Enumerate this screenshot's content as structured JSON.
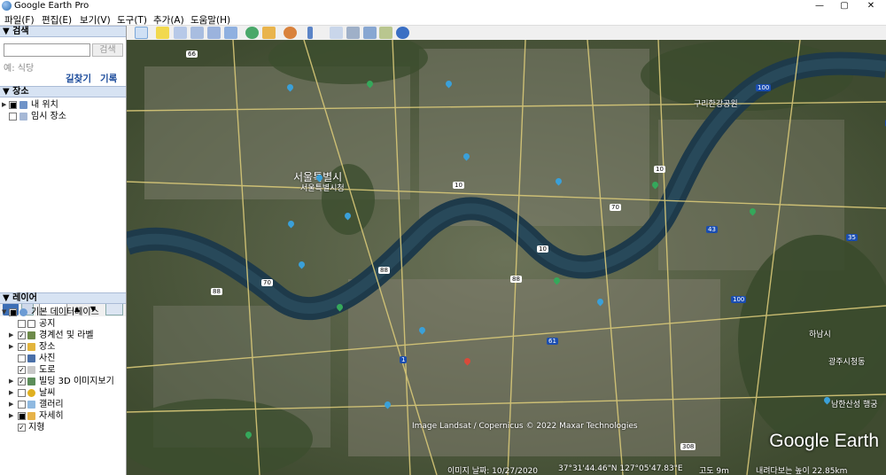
{
  "window": {
    "title": "Google Earth Pro",
    "minimize": "—",
    "maximize": "▢",
    "close": "✕"
  },
  "menu": [
    "파일(F)",
    "편집(E)",
    "보기(V)",
    "도구(T)",
    "추가(A)",
    "도움말(H)"
  ],
  "search": {
    "header": "검색",
    "button": "검색",
    "hint": "예: 식당",
    "directions": "길찾기",
    "history": "기록"
  },
  "places": {
    "header": "장소",
    "items": [
      {
        "label": "내 위치"
      },
      {
        "label": "임시 장소"
      }
    ]
  },
  "layers": {
    "header": "레이어",
    "items": [
      {
        "label": "기본 데이터베이스",
        "checked": false
      },
      {
        "label": "공지",
        "checked": false
      },
      {
        "label": "경계선 및 라벨",
        "checked": true
      },
      {
        "label": "장소",
        "checked": true
      },
      {
        "label": "사진",
        "checked": false
      },
      {
        "label": "도로",
        "checked": true
      },
      {
        "label": "빌딩 3D 이미지보기",
        "checked": true
      },
      {
        "label": "날씨",
        "checked": false
      },
      {
        "label": "갤러리",
        "checked": false
      },
      {
        "label": "자세히",
        "checked": false
      },
      {
        "label": "지형",
        "checked": true
      }
    ]
  },
  "map": {
    "labels": {
      "seoul": "서울특별시",
      "seoul_city_hall": "서울특별시청",
      "guri": "구리한강공원",
      "hanam": "하남시",
      "gwangju": "광주시청동",
      "namhansanseong": "남한산성 행궁"
    },
    "highways": [
      "66",
      "70",
      "70",
      "10",
      "10",
      "10",
      "88",
      "88",
      "88",
      "43",
      "35",
      "100",
      "100",
      "61",
      "1",
      "308",
      "100"
    ],
    "copyright": "Image Landsat / Copernicus   © 2022 Maxar Technologies",
    "brand": "Google Earth",
    "status": {
      "imagery_date": "이미지 날짜: 10/27/2020",
      "coords": "37°31'44.46\"N  127°05'47.83\"E",
      "elevation": "고도   9m",
      "eye_alt": "내려다보는 높이  22.85km"
    }
  },
  "colors": {
    "panel_header": "#d7e3f3",
    "link": "#1a4a9a",
    "river": "#1e3a4a"
  }
}
